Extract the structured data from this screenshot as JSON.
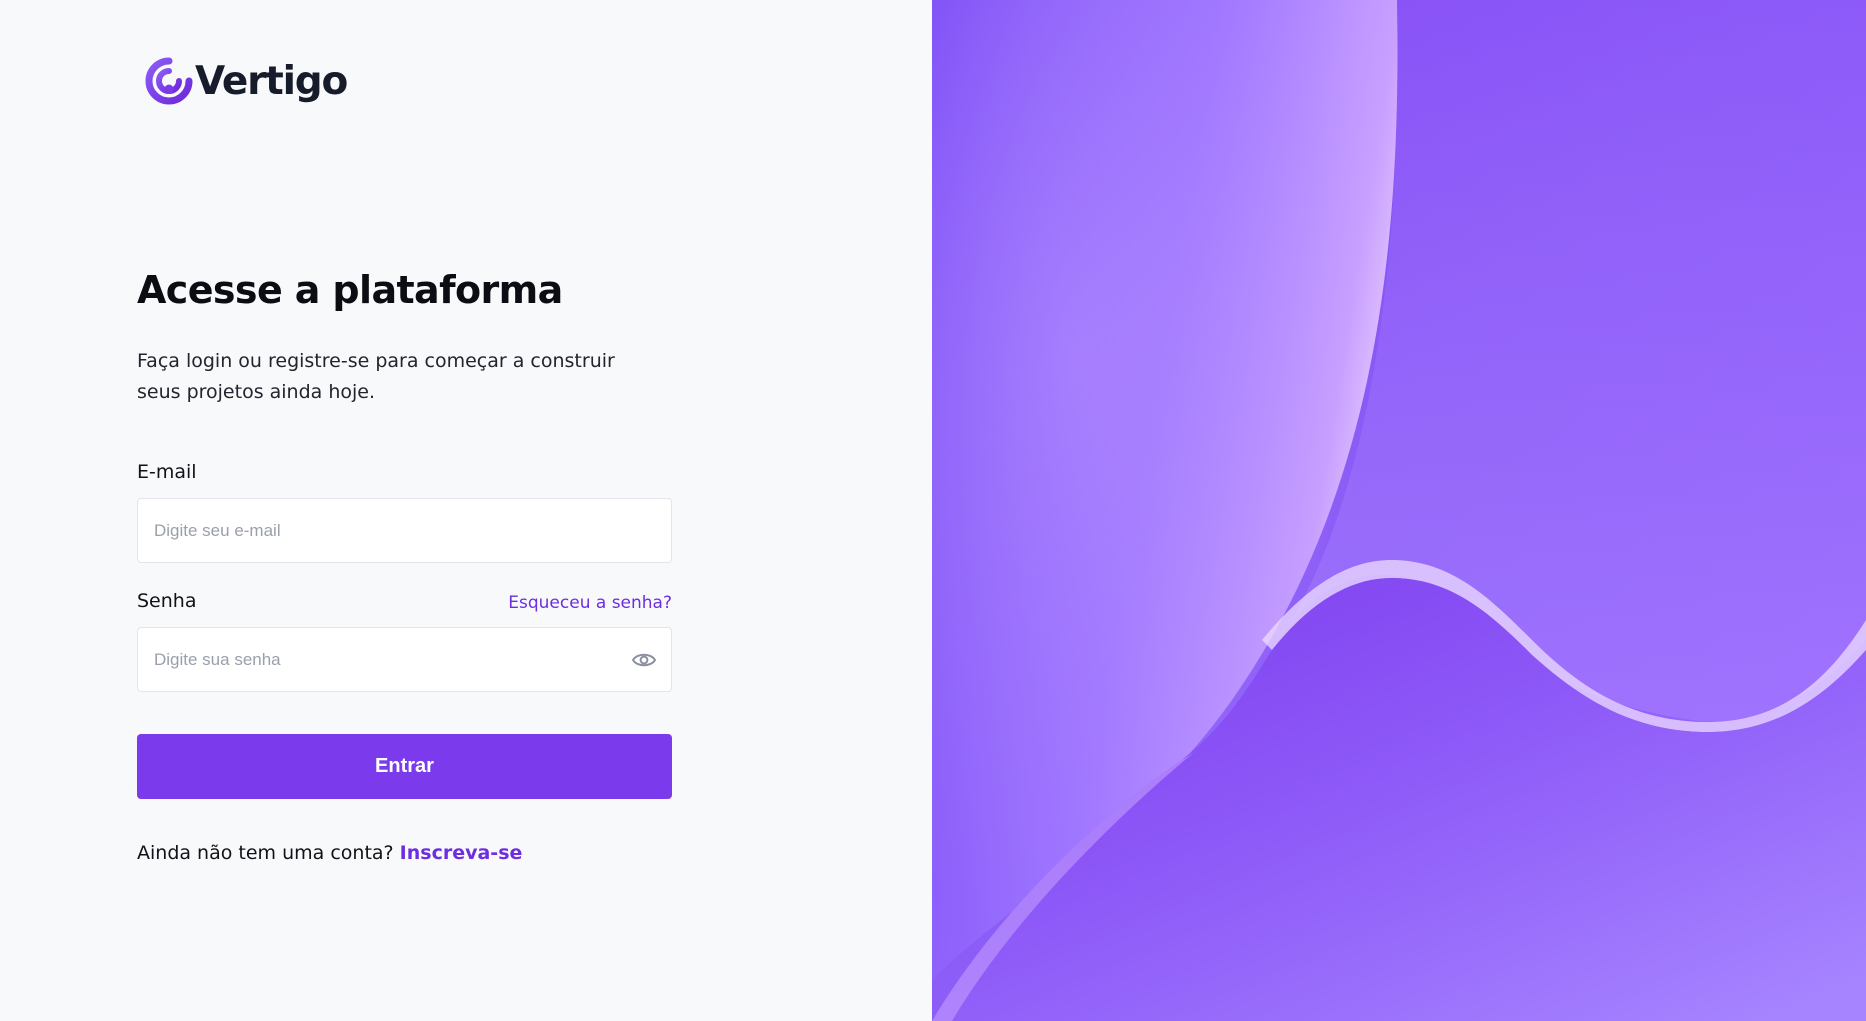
{
  "brand": {
    "name": "Vertigo",
    "accent_color": "#7c3aed",
    "logo_icon": "signal-arc-logo-icon"
  },
  "login": {
    "title": "Acesse a plataforma",
    "subtitle": "Faça login ou registre-se para começar a construir seus projetos ainda hoje.",
    "email": {
      "label": "E-mail",
      "placeholder": "Digite seu e-mail",
      "value": ""
    },
    "password": {
      "label": "Senha",
      "placeholder": "Digite sua senha",
      "value": "",
      "forgot_link": "Esqueceu a senha?",
      "toggle_icon": "eye-icon"
    },
    "submit_label": "Entrar",
    "signup_prompt": "Ainda não tem uma conta?",
    "signup_link": "Inscreva-se"
  },
  "colors": {
    "page_background": "#f8f9fb",
    "text_primary": "#0b0d12",
    "link": "#6d2ee0",
    "button_background": "#7c3aed",
    "artwork_purple": "#8653f7",
    "artwork_light": "#c99bff"
  }
}
